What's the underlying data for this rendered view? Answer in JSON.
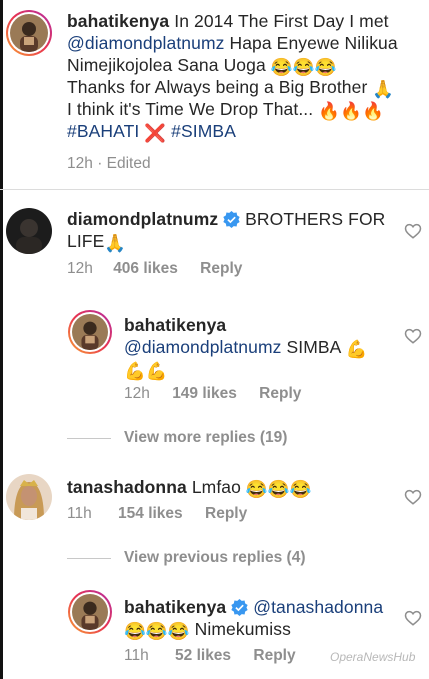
{
  "comments": [
    {
      "username": "bahatikenya",
      "line1_text": "In 2014 The First Day I met",
      "line2_mention": "@diamondplatnumz",
      "line2_text": "Hapa Enyewe Nilikua",
      "line3_text": "Nimejikojolea  Sana Uoga",
      "line4_text": "Thanks for Always being a Big Brother",
      "line5_text": "I think it's Time We Drop That...",
      "tag1": "#BAHATI",
      "tag2": "#SIMBA",
      "time": "12h",
      "edited": "Edited"
    },
    {
      "username": "diamondplatnumz",
      "text1": "BROTHERS FOR",
      "text2": "LIFE",
      "time": "12h",
      "likes": "406 likes",
      "reply": "Reply"
    },
    {
      "username": "bahatikenya",
      "mention": "@diamondplatnumz",
      "text": "SIMBA",
      "time": "12h",
      "likes": "149 likes",
      "reply": "Reply"
    },
    {
      "username": "tanashadonna",
      "text": "Lmfao",
      "time": "11h",
      "likes": "154 likes",
      "reply": "Reply"
    },
    {
      "username": "bahatikenya",
      "mention": "@tanashadonna",
      "text": "Nimekumiss",
      "time": "11h",
      "likes": "52 likes",
      "reply": "Reply"
    }
  ],
  "view_more_replies": "View more replies (19)",
  "view_previous_replies": "View previous replies (4)",
  "watermark": "OperaNewsHub",
  "icons": {
    "heart": "heart-outline-icon",
    "verified": "verified-badge-icon"
  },
  "colors": {
    "mention": "#1a3f7a",
    "meta": "#8e8e8e",
    "verified": "#3897f0"
  }
}
